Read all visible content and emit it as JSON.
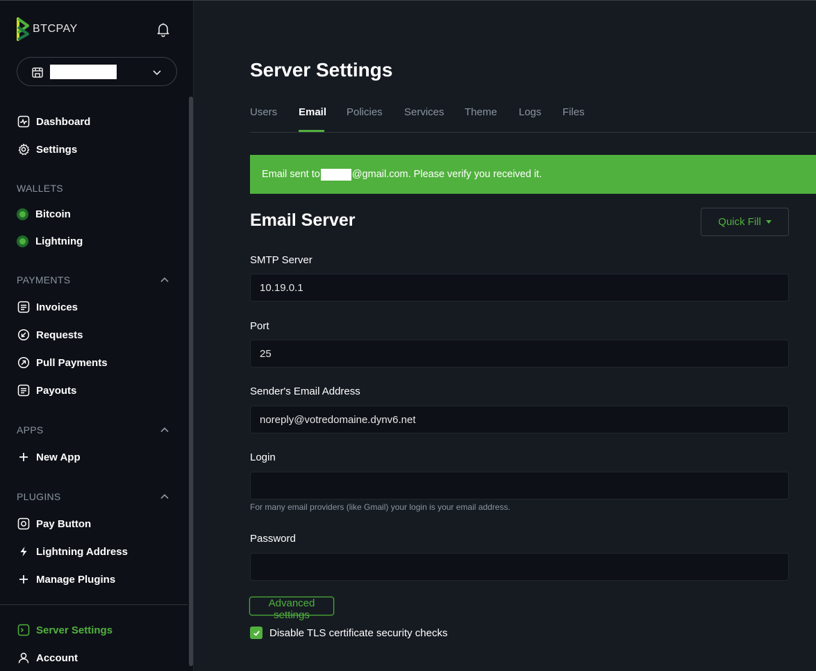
{
  "app": {
    "logo_text": "BTCPAY"
  },
  "sidebar": {
    "main_items": [
      {
        "label": "Dashboard",
        "icon": "dashboard-icon"
      },
      {
        "label": "Settings",
        "icon": "gear-icon"
      }
    ],
    "wallets": {
      "title": "WALLETS",
      "items": [
        {
          "label": "Bitcoin",
          "status_color": "#51b13e"
        },
        {
          "label": "Lightning",
          "status_color": "#51b13e"
        }
      ]
    },
    "payments": {
      "title": "PAYMENTS",
      "items": [
        {
          "label": "Invoices",
          "icon": "invoice-icon"
        },
        {
          "label": "Requests",
          "icon": "request-icon"
        },
        {
          "label": "Pull Payments",
          "icon": "pull-payment-icon"
        },
        {
          "label": "Payouts",
          "icon": "payout-icon"
        }
      ]
    },
    "apps": {
      "title": "APPS",
      "items": [
        {
          "label": "New App",
          "icon": "plus-icon"
        }
      ]
    },
    "plugins": {
      "title": "PLUGINS",
      "items": [
        {
          "label": "Pay Button",
          "icon": "pay-button-icon"
        },
        {
          "label": "Lightning Address",
          "icon": "lightning-icon"
        },
        {
          "label": "Manage Plugins",
          "icon": "plus-icon"
        }
      ]
    },
    "footer_items": [
      {
        "label": "Server Settings",
        "icon": "server-settings-icon"
      },
      {
        "label": "Account",
        "icon": "user-icon"
      }
    ]
  },
  "main": {
    "title": "Server Settings",
    "tabs": [
      {
        "label": "Users"
      },
      {
        "label": "Email"
      },
      {
        "label": "Policies"
      },
      {
        "label": "Services"
      },
      {
        "label": "Theme"
      },
      {
        "label": "Logs"
      },
      {
        "label": "Files"
      }
    ],
    "active_tab": "Email",
    "alert": {
      "prefix": "Email sent to",
      "suffix": "@gmail.com. Please verify you received it."
    },
    "section_title": "Email Server",
    "quick_fill_label": "Quick Fill",
    "fields": {
      "smtp": {
        "label": "SMTP Server",
        "value": "10.19.0.1"
      },
      "port": {
        "label": "Port",
        "value": "25"
      },
      "sender": {
        "label": "Sender's Email Address",
        "value": "noreply@votredomaine.dynv6.net"
      },
      "login": {
        "label": "Login",
        "value": "",
        "hint": "For many email providers (like Gmail) your login is your email address."
      },
      "password": {
        "label": "Password",
        "value": ""
      }
    },
    "advanced_label": "Advanced settings",
    "tls_checkbox": {
      "label": "Disable TLS certificate security checks",
      "checked": true
    }
  },
  "colors": {
    "accent": "#51b13e",
    "background": "#161b22",
    "sidebar": "#0d1117"
  }
}
